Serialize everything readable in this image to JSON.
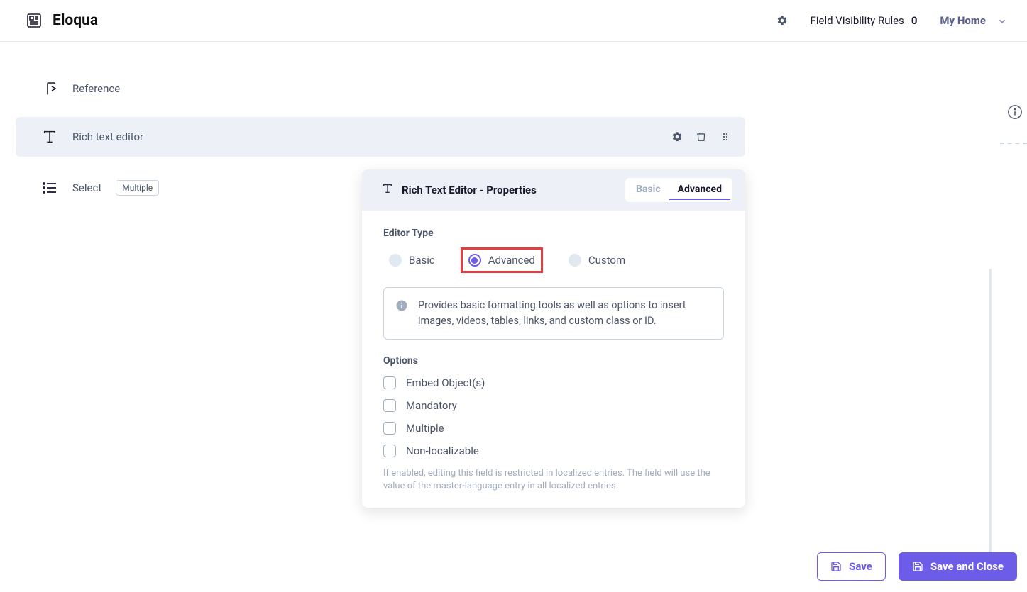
{
  "header": {
    "app_title": "Eloqua",
    "fvr_label": "Field Visibility Rules",
    "fvr_count": "0",
    "myhome_label": "My Home"
  },
  "fields": {
    "reference": {
      "label": "Reference"
    },
    "rte": {
      "label": "Rich text editor"
    },
    "select": {
      "label": "Select",
      "badge": "Multiple"
    }
  },
  "panel": {
    "title": "Rich Text Editor - Properties",
    "tabs": {
      "basic": "Basic",
      "advanced": "Advanced"
    },
    "editor_type": {
      "label": "Editor Type",
      "basic": "Basic",
      "advanced": "Advanced",
      "custom": "Custom"
    },
    "info_text": "Provides basic formatting tools as well as options to insert images, videos, tables, links, and custom class or ID.",
    "options": {
      "label": "Options",
      "embed": "Embed Object(s)",
      "mandatory": "Mandatory",
      "multiple": "Multiple",
      "non_localizable": "Non-localizable"
    },
    "helper": "If enabled, editing this field is restricted in localized entries. The field will use the value of the master-language entry in all localized entries."
  },
  "footer": {
    "save": "Save",
    "save_close": "Save and Close"
  }
}
